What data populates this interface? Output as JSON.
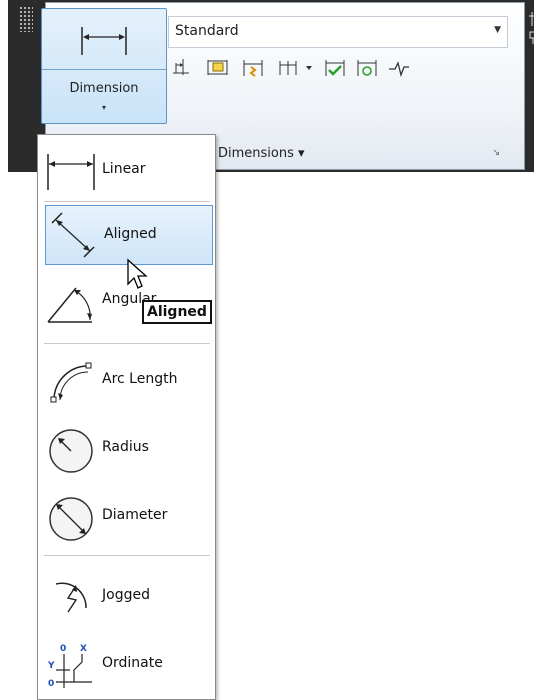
{
  "ribbon": {
    "dimension_button": {
      "label": "Dimension",
      "arrow": "▾",
      "icon": "linear-dimension-icon"
    },
    "style_combo": {
      "value": "Standard",
      "arrow": "▼"
    },
    "tools": [
      {
        "name": "dimbaseline-icon"
      },
      {
        "name": "dimspace-icon"
      },
      {
        "name": "dimbreak-icon"
      },
      {
        "name": "dimcontinue-icon"
      },
      {
        "name": "dimension-update-icon"
      },
      {
        "name": "reassociate-icon"
      },
      {
        "name": "jogline-icon"
      }
    ],
    "footer": {
      "label": "Dimensions",
      "arrow": "▾",
      "launcher": "↘"
    },
    "accent": "#5b9bd5"
  },
  "menu": {
    "items": [
      {
        "label": "Linear",
        "icon": "linear-icon"
      },
      {
        "label": "Aligned",
        "icon": "aligned-icon",
        "selected": true
      },
      {
        "label": "Angular",
        "icon": "angular-icon"
      },
      {
        "label": "Arc Length",
        "icon": "arc-length-icon"
      },
      {
        "label": "Radius",
        "icon": "radius-icon"
      },
      {
        "label": "Diameter",
        "icon": "diameter-icon"
      },
      {
        "label": "Jogged",
        "icon": "jogged-icon"
      },
      {
        "label": "Ordinate",
        "icon": "ordinate-icon"
      }
    ]
  },
  "tooltip": {
    "text": "Aligned"
  }
}
